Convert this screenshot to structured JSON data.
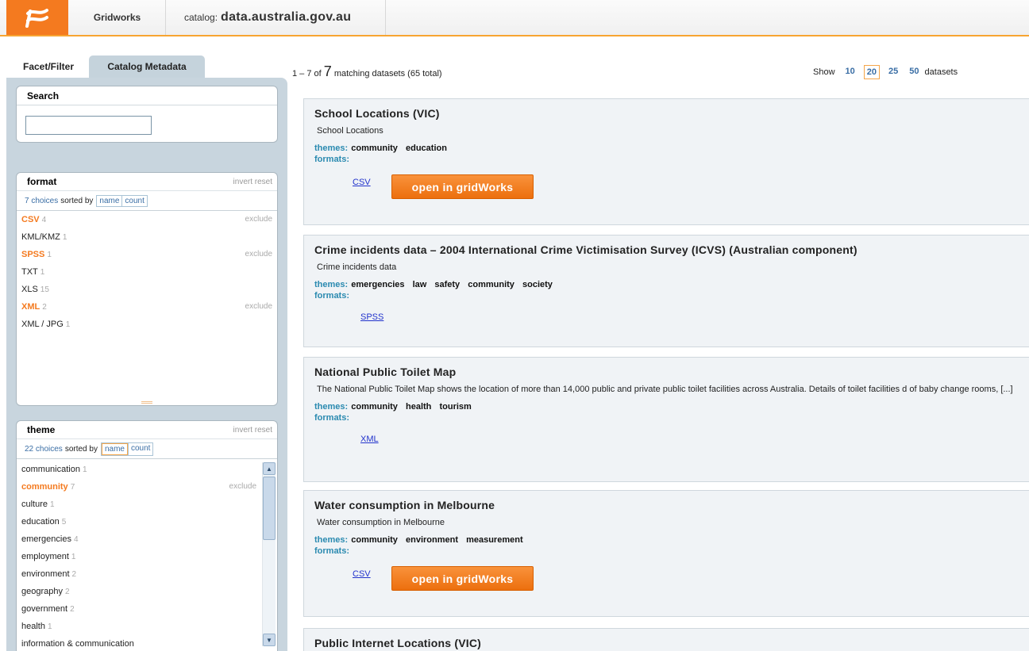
{
  "header": {
    "app_name": "Gridworks",
    "catalog_label": "catalog:",
    "catalog_value": "data.australia.gov.au"
  },
  "left_tabs": {
    "facet": "Facet/Filter",
    "catalog": "Catalog Metadata"
  },
  "search": {
    "title": "Search",
    "value": ""
  },
  "format_facet": {
    "title": "format",
    "invert_reset": "invert reset",
    "choices_text": "7 choices",
    "sorted_by": "sorted by",
    "sort_name": "name",
    "sort_count": "count",
    "items": [
      {
        "name": "CSV",
        "count": "4",
        "selected": true,
        "exclude": "exclude"
      },
      {
        "name": "KML/KMZ",
        "count": "1",
        "selected": false,
        "exclude": ""
      },
      {
        "name": "SPSS",
        "count": "1",
        "selected": true,
        "exclude": "exclude"
      },
      {
        "name": "TXT",
        "count": "1",
        "selected": false,
        "exclude": ""
      },
      {
        "name": "XLS",
        "count": "15",
        "selected": false,
        "exclude": ""
      },
      {
        "name": "XML",
        "count": "2",
        "selected": true,
        "exclude": "exclude"
      },
      {
        "name": "XML / JPG",
        "count": "1",
        "selected": false,
        "exclude": ""
      }
    ]
  },
  "theme_facet": {
    "title": "theme",
    "invert_reset": "invert reset",
    "choices_text": "22 choices",
    "sorted_by": "sorted by",
    "sort_name": "name",
    "sort_count": "count",
    "items": [
      {
        "name": "communication",
        "count": "1",
        "selected": false,
        "exclude": ""
      },
      {
        "name": "community",
        "count": "7",
        "selected": true,
        "exclude": "exclude"
      },
      {
        "name": "culture",
        "count": "1",
        "selected": false,
        "exclude": ""
      },
      {
        "name": "education",
        "count": "5",
        "selected": false,
        "exclude": ""
      },
      {
        "name": "emergencies",
        "count": "4",
        "selected": false,
        "exclude": ""
      },
      {
        "name": "employment",
        "count": "1",
        "selected": false,
        "exclude": ""
      },
      {
        "name": "environment",
        "count": "2",
        "selected": false,
        "exclude": ""
      },
      {
        "name": "geography",
        "count": "2",
        "selected": false,
        "exclude": ""
      },
      {
        "name": "government",
        "count": "2",
        "selected": false,
        "exclude": ""
      },
      {
        "name": "health",
        "count": "1",
        "selected": false,
        "exclude": ""
      },
      {
        "name": "information & communication",
        "count": "",
        "selected": false,
        "exclude": ""
      }
    ]
  },
  "results": {
    "range": "1 – 7 of",
    "matching": "7",
    "suffix": "matching datasets (65 total)"
  },
  "show": {
    "label": "Show",
    "options": [
      "10",
      "20",
      "25",
      "50"
    ],
    "selected": "20",
    "suffix": "datasets"
  },
  "labels": {
    "themes": "themes:",
    "formats": "formats:",
    "open_button": "open in gridWorks"
  },
  "datasets": [
    {
      "title": "School Locations (VIC)",
      "description": "School Locations",
      "themes": [
        "community",
        "education"
      ],
      "format_link": "CSV",
      "has_open_button": true
    },
    {
      "title": "Crime incidents data – 2004 International Crime Victimisation Survey (ICVS) (Australian component)",
      "description": "Crime incidents data",
      "themes": [
        "emergencies",
        "law",
        "safety",
        "community",
        "society"
      ],
      "format_link": "SPSS",
      "has_open_button": false
    },
    {
      "title": "National Public Toilet Map",
      "description": "The National Public Toilet Map shows the location of more than 14,000 public and private public toilet facilities across Australia. Details of toilet facilities d of baby change rooms, [...]",
      "themes": [
        "community",
        "health",
        "tourism"
      ],
      "format_link": "XML",
      "has_open_button": false
    },
    {
      "title": "Water consumption in Melbourne",
      "description": "Water consumption in Melbourne",
      "themes": [
        "community",
        "environment",
        "measurement"
      ],
      "format_link": "CSV",
      "has_open_button": true
    },
    {
      "title": "Public Internet Locations (VIC)",
      "description": "",
      "themes": [],
      "format_link": "",
      "has_open_button": false
    }
  ],
  "colors": {
    "accent": "#f47a1f",
    "panel": "#c8d5de",
    "link": "#2233cc",
    "meta_key": "#2a8ab0"
  },
  "icons": {
    "logo": "gridworks-logo-icon",
    "scroll_up": "arrow-up-icon",
    "scroll_down": "arrow-down-icon"
  }
}
